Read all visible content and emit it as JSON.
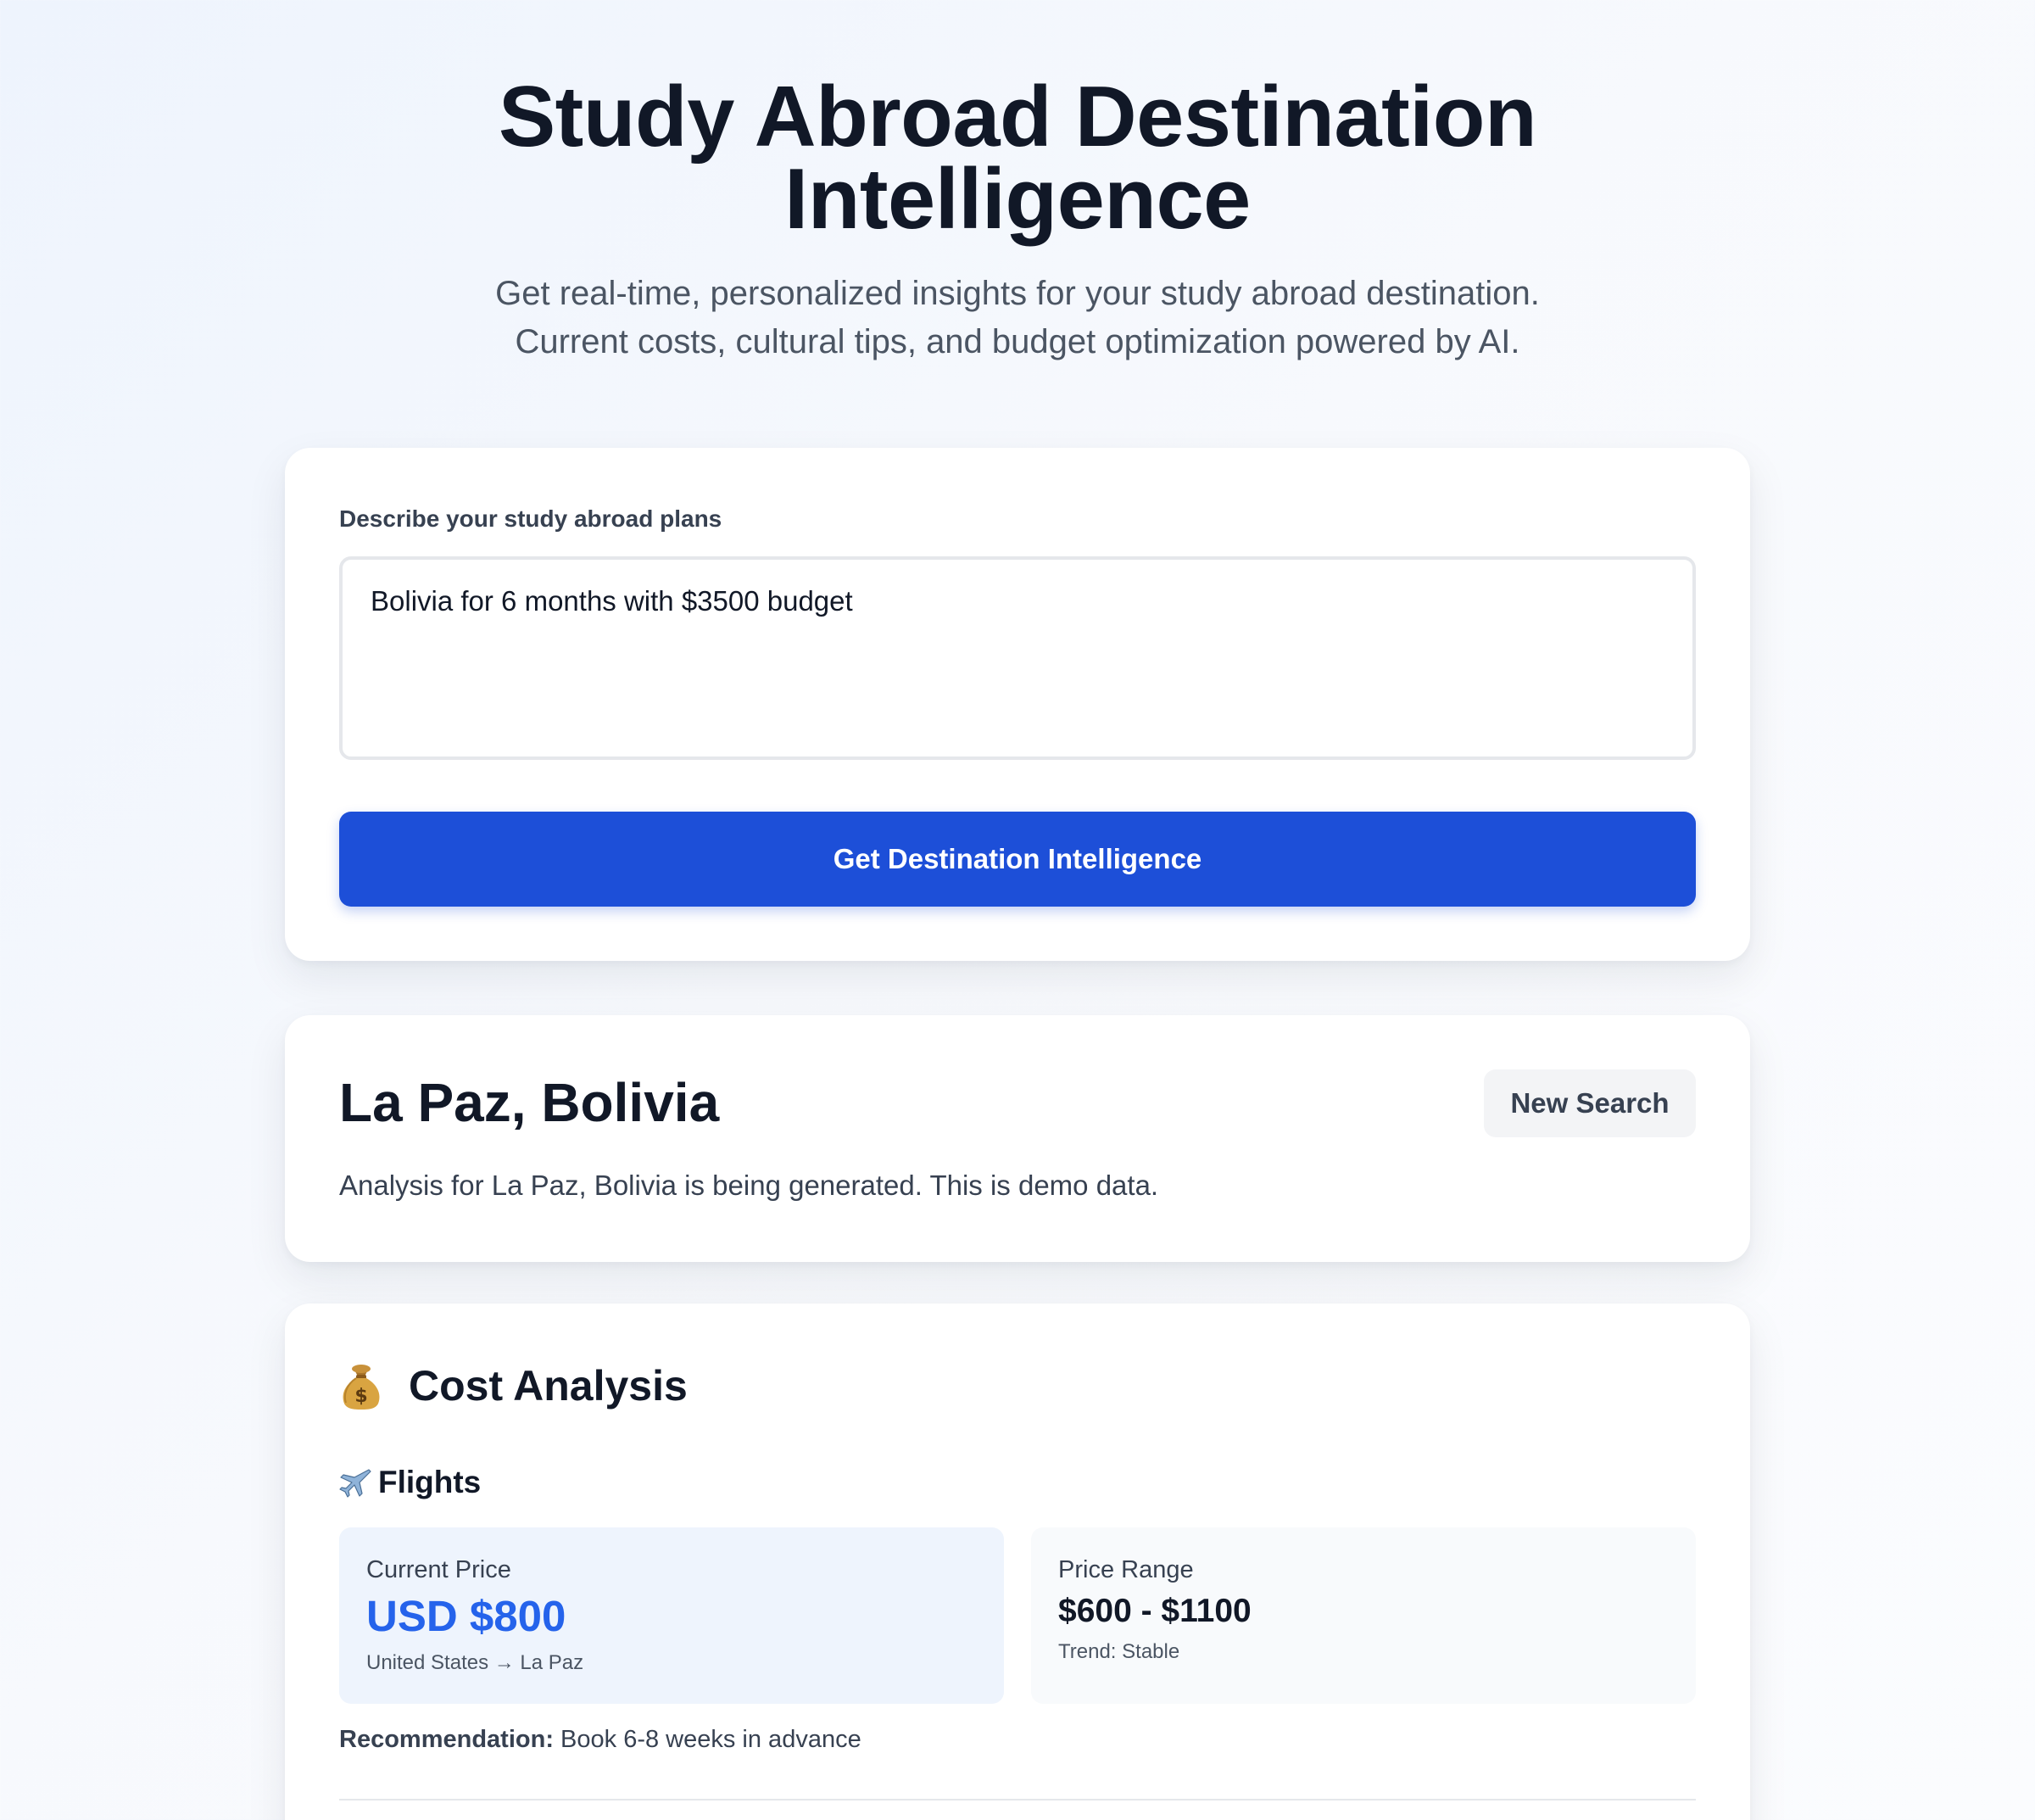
{
  "hero": {
    "title_line1": "Study Abroad Destination",
    "title_line2": "Intelligence",
    "subtitle_line1": "Get real-time, personalized insights for your study abroad destination.",
    "subtitle_line2": "Current costs, cultural tips, and budget optimization powered by AI."
  },
  "form": {
    "label": "Describe your study abroad plans",
    "input_value": "Bolivia for 6 months with $3500 budget",
    "submit_label": "Get Destination Intelligence"
  },
  "result": {
    "destination": "La Paz, Bolivia",
    "new_search_label": "New Search",
    "description": "Analysis for La Paz, Bolivia is being generated. This is demo data."
  },
  "cost_analysis": {
    "icon": "moneybag-icon",
    "title": "Cost Analysis",
    "flights": {
      "icon": "airplane-icon",
      "title": "Flights",
      "current_price_label": "Current Price",
      "current_price_value": "USD $800",
      "route": "United States → La Paz",
      "price_range_label": "Price Range",
      "price_range_value": "$600 - $1100",
      "trend": "Trend: Stable",
      "recommendation_label": "Recommendation:",
      "recommendation_text": "Book 6-8 weeks in advance"
    }
  },
  "colors": {
    "primary_button": "#1d4fd8",
    "price_accent": "#2563eb"
  }
}
